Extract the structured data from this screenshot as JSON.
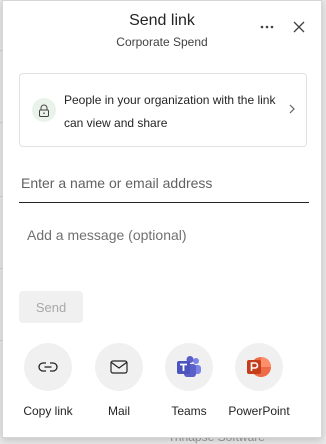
{
  "background": {
    "partial_text": "Trinapse Software"
  },
  "header": {
    "title": "Send link",
    "subtitle": "Corporate Spend"
  },
  "link_settings": {
    "description": "People in your organization with the link can view and share",
    "icon": "lock-icon"
  },
  "recipient_input": {
    "placeholder": "Enter a name or email address"
  },
  "message_input": {
    "placeholder": "Add a message (optional)"
  },
  "send_button": {
    "label": "Send"
  },
  "share_options": [
    {
      "label": "Copy link",
      "icon": "link-icon"
    },
    {
      "label": "Mail",
      "icon": "mail-icon"
    },
    {
      "label": "Teams",
      "icon": "teams-icon"
    },
    {
      "label": "PowerPoint",
      "icon": "powerpoint-icon"
    }
  ],
  "colors": {
    "lock_bg": "#eaf3ea",
    "teams": "#5b5fc7",
    "powerpoint": "#c43e1c"
  }
}
